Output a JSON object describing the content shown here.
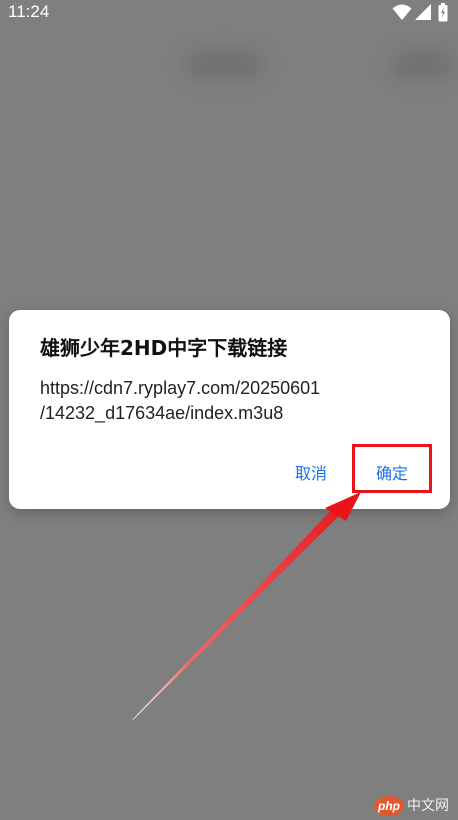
{
  "status_bar": {
    "time": "11:24",
    "icons": [
      "wifi-icon",
      "signal-icon",
      "battery-icon"
    ]
  },
  "dialog": {
    "title": "雄狮少年2HD中字下载链接",
    "message_lines": [
      "https://cdn7.ryplay7.com/20250601",
      "/14232_d17634ae/index.m3u8"
    ],
    "buttons": {
      "cancel": "取消",
      "confirm": "确定"
    }
  },
  "annotation": {
    "highlight_color": "#e8141a",
    "arrow_color": "#e8141a",
    "target": "confirm"
  },
  "watermark": {
    "badge": "php",
    "text": "中文网"
  },
  "colors": {
    "scrim": "#7f7f7f",
    "dialog_background": "#ffffff",
    "button_text": "#1a73e8"
  }
}
